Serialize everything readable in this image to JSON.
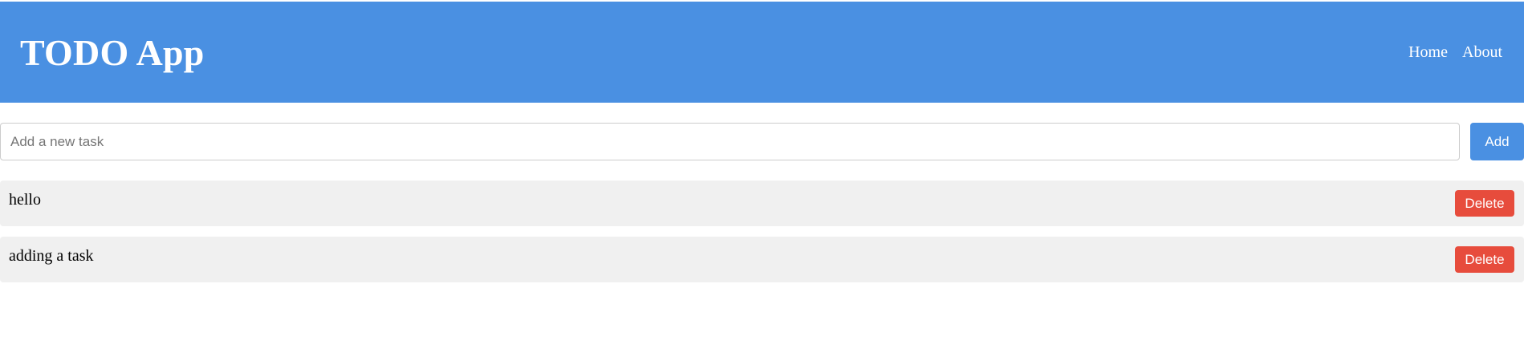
{
  "header": {
    "title": "TODO App",
    "nav": [
      {
        "label": "Home"
      },
      {
        "label": "About"
      }
    ]
  },
  "add_task": {
    "placeholder": "Add a new task",
    "value": "",
    "button_label": "Add"
  },
  "tasks": [
    {
      "text": "hello",
      "delete_label": "Delete"
    },
    {
      "text": "adding a task",
      "delete_label": "Delete"
    }
  ],
  "colors": {
    "header_bg": "#4a90e2",
    "add_button": "#4a90e2",
    "delete_button": "#e74c3c",
    "task_bg": "#f0f0f0"
  }
}
